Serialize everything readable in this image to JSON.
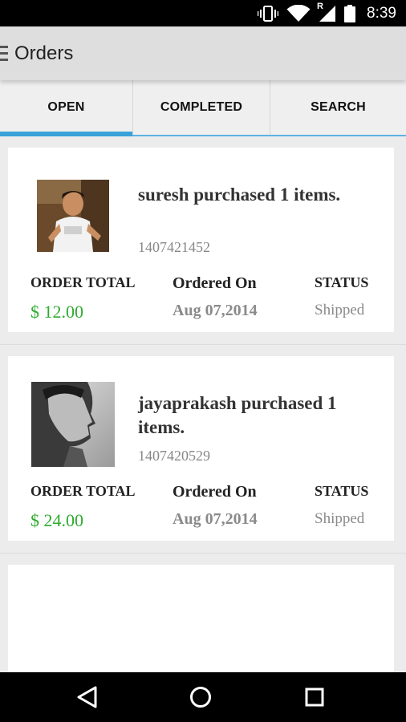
{
  "status_bar": {
    "time": "8:39",
    "roaming_indicator": "R",
    "icons": [
      "vibrate-icon",
      "wifi-icon",
      "signal-icon",
      "battery-icon"
    ]
  },
  "app_bar": {
    "title": "Orders",
    "menu_icon": "hamburger-menu-icon"
  },
  "tabs": [
    {
      "label": "OPEN",
      "active": true
    },
    {
      "label": "COMPLETED",
      "active": false
    },
    {
      "label": "SEARCH",
      "active": false
    }
  ],
  "labels": {
    "order_total": "ORDER TOTAL",
    "ordered_on": "Ordered On",
    "status": "STATUS"
  },
  "orders": [
    {
      "headline": "suresh purchased 1 items.",
      "order_id": "1407421452",
      "total": "$ 12.00",
      "date": "Aug 07,2014",
      "status": "Shipped"
    },
    {
      "headline": "jayaprakash purchased 1 items.",
      "order_id": "1407420529",
      "total": "$ 24.00",
      "date": "Aug 07,2014",
      "status": "Shipped"
    }
  ],
  "colors": {
    "accent": "#3aa1d9",
    "price": "#2eab2e",
    "muted": "#8a8a8a"
  },
  "nav_bar": {
    "icons": [
      "back-icon",
      "home-icon",
      "recent-apps-icon"
    ]
  }
}
